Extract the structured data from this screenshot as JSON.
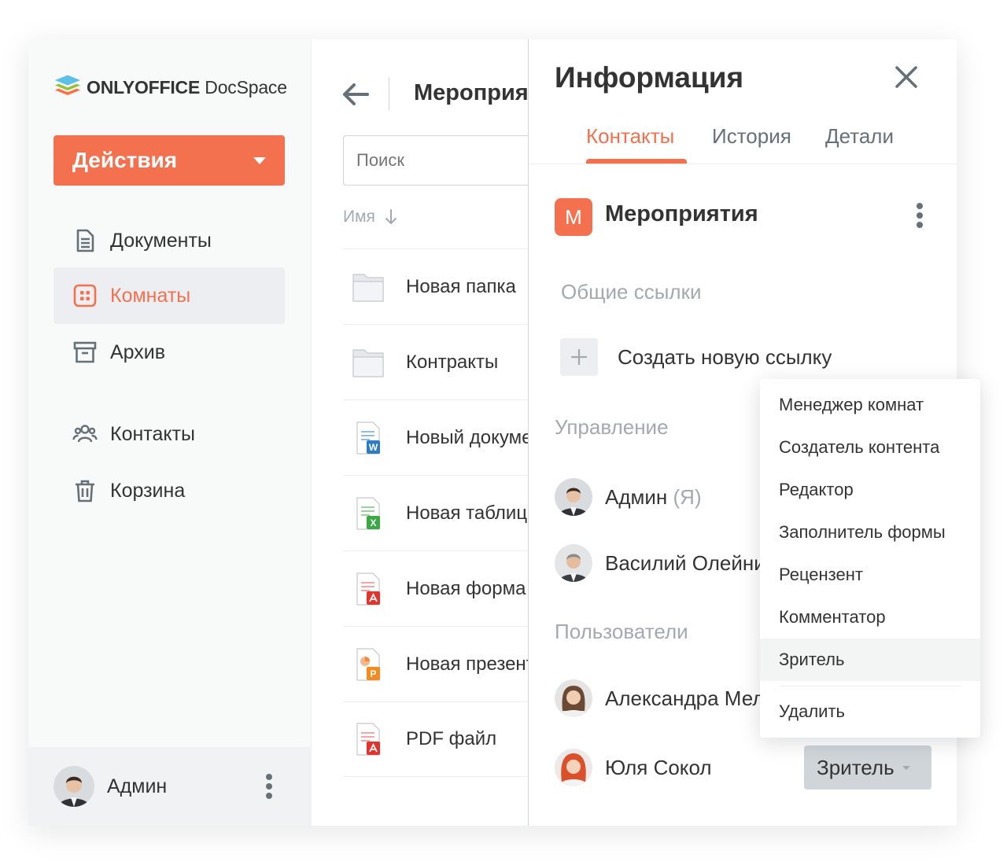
{
  "app": {
    "brand_bold": "ONLYOFFICE",
    "brand_light": " DocSpace"
  },
  "colors": {
    "accent": "#f4714f",
    "muted": "#a3a9ae",
    "text": "#333333"
  },
  "sidebar": {
    "actions_label": "Действия",
    "items": [
      {
        "label": "Документы",
        "icon": "document-icon",
        "active": false
      },
      {
        "label": "Комнаты",
        "icon": "rooms-icon",
        "active": true
      },
      {
        "label": "Архив",
        "icon": "archive-icon",
        "active": false
      },
      {
        "label": "Контакты",
        "icon": "contacts-icon",
        "active": false
      },
      {
        "label": "Корзина",
        "icon": "trash-icon",
        "active": false
      }
    ],
    "profile_name": "Админ"
  },
  "files": {
    "title": "Мероприятия",
    "search_placeholder": "Поиск",
    "sort_label": "Имя",
    "rows": [
      {
        "name": "Новая папка",
        "icon": "folder-icon"
      },
      {
        "name": "Контракты",
        "icon": "folder-icon"
      },
      {
        "name": "Новый документ",
        "icon": "word-document-icon"
      },
      {
        "name": "Новая таблица",
        "icon": "spreadsheet-icon"
      },
      {
        "name": "Новая форма",
        "icon": "pdf-form-icon"
      },
      {
        "name": "Новая презентация",
        "icon": "presentation-icon"
      },
      {
        "name": "PDF файл",
        "icon": "pdf-file-icon"
      }
    ]
  },
  "info": {
    "title": "Информация",
    "tabs": [
      {
        "label": "Контакты",
        "active": true
      },
      {
        "label": "История",
        "active": false
      },
      {
        "label": "Детали",
        "active": false
      }
    ],
    "room_initial": "М",
    "room_name": "Мероприятия",
    "shared_links_label": "Общие ссылки",
    "create_link_label": "Создать новую ссылку",
    "management_label": "Управление",
    "managers": [
      {
        "name": "Админ",
        "suffix": " (Я)"
      },
      {
        "name": "Василий Олейник"
      }
    ],
    "users_label": "Пользователи",
    "users": [
      {
        "name": "Александра Мельникова"
      },
      {
        "name": "Юля Сокол",
        "role": "Зритель"
      }
    ]
  },
  "role_menu": {
    "items": [
      {
        "label": "Менеджер комнат",
        "selected": false
      },
      {
        "label": "Создатель контента",
        "selected": false
      },
      {
        "label": "Редактор",
        "selected": false
      },
      {
        "label": "Заполнитель формы",
        "selected": false
      },
      {
        "label": "Рецензент",
        "selected": false
      },
      {
        "label": "Комментатор",
        "selected": false
      },
      {
        "label": "Зритель",
        "selected": true
      }
    ],
    "delete_label": "Удалить"
  }
}
